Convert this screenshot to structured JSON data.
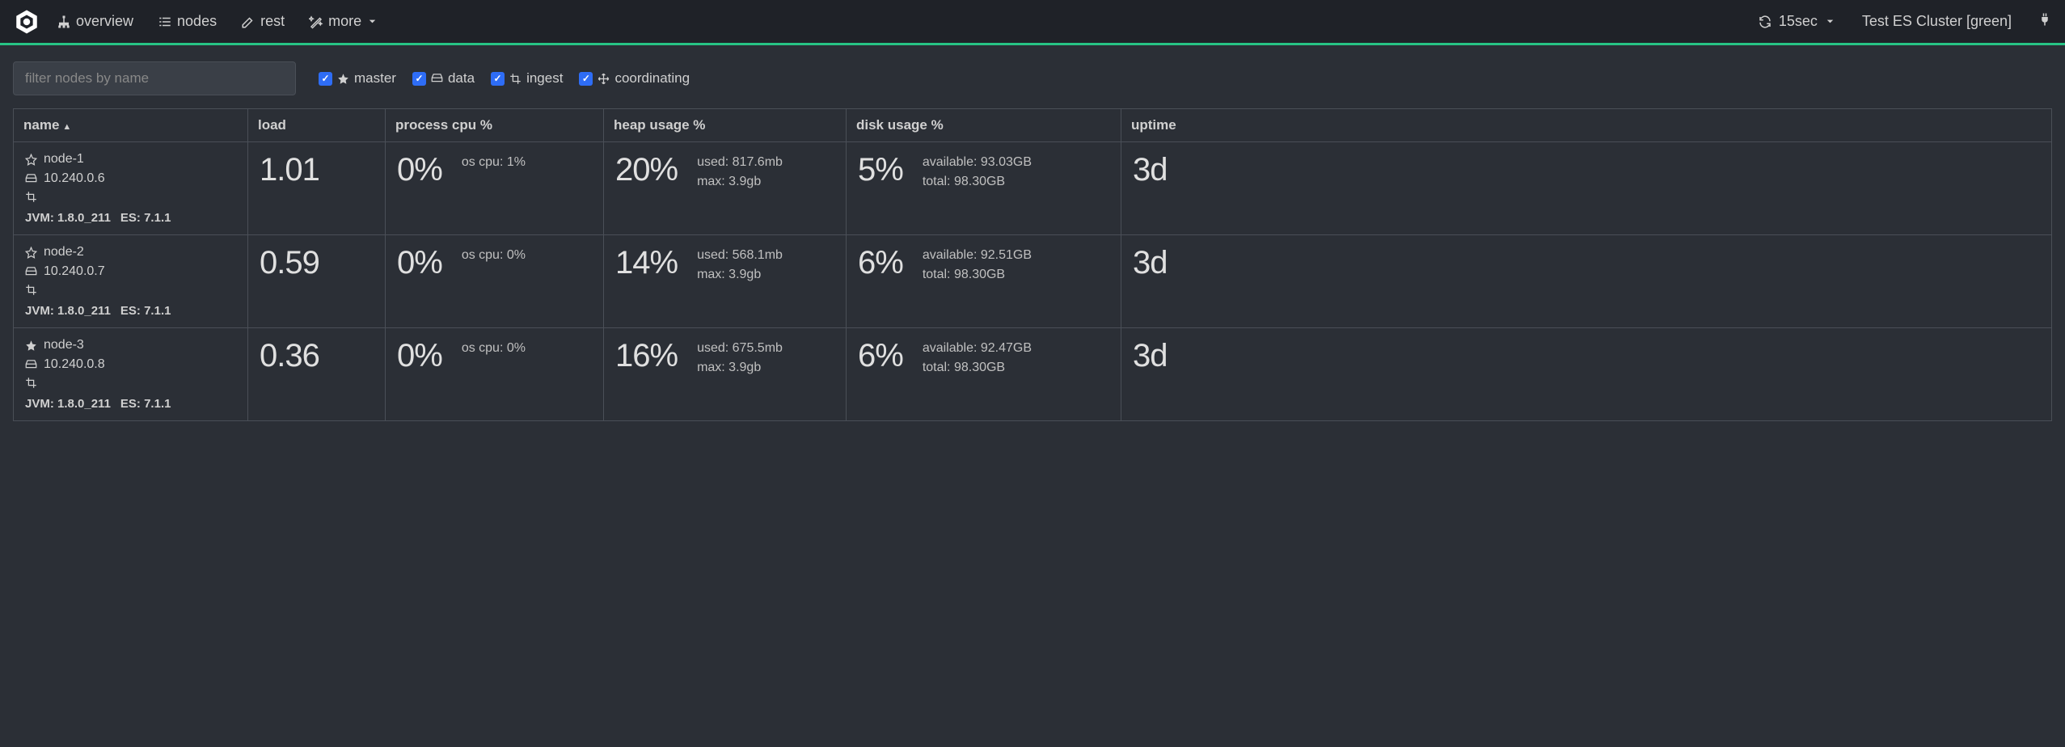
{
  "nav": {
    "overview": "overview",
    "nodes": "nodes",
    "rest": "rest",
    "more": "more"
  },
  "header": {
    "refresh_interval": "15sec",
    "cluster_name": "Test ES Cluster [green]"
  },
  "toolbar": {
    "filter_placeholder": "filter nodes by name",
    "roles": {
      "master": "master",
      "data": "data",
      "ingest": "ingest",
      "coordinating": "coordinating"
    }
  },
  "columns": {
    "name": "name",
    "load": "load",
    "process_cpu": "process cpu %",
    "heap": "heap usage %",
    "disk": "disk usage %",
    "uptime": "uptime"
  },
  "rows": [
    {
      "name": "node-1",
      "ip": "10.240.0.6",
      "is_master": false,
      "jvm": "JVM: 1.8.0_211",
      "es": "ES: 7.1.1",
      "load": "1.01",
      "cpu": "0%",
      "os_cpu": "os cpu: 1%",
      "heap": "20%",
      "heap_used": "used: 817.6mb",
      "heap_max": "max: 3.9gb",
      "disk": "5%",
      "disk_avail": "available: 93.03GB",
      "disk_total": "total: 98.30GB",
      "uptime": "3d"
    },
    {
      "name": "node-2",
      "ip": "10.240.0.7",
      "is_master": false,
      "jvm": "JVM: 1.8.0_211",
      "es": "ES: 7.1.1",
      "load": "0.59",
      "cpu": "0%",
      "os_cpu": "os cpu: 0%",
      "heap": "14%",
      "heap_used": "used: 568.1mb",
      "heap_max": "max: 3.9gb",
      "disk": "6%",
      "disk_avail": "available: 92.51GB",
      "disk_total": "total: 98.30GB",
      "uptime": "3d"
    },
    {
      "name": "node-3",
      "ip": "10.240.0.8",
      "is_master": true,
      "jvm": "JVM: 1.8.0_211",
      "es": "ES: 7.1.1",
      "load": "0.36",
      "cpu": "0%",
      "os_cpu": "os cpu: 0%",
      "heap": "16%",
      "heap_used": "used: 675.5mb",
      "heap_max": "max: 3.9gb",
      "disk": "6%",
      "disk_avail": "available: 92.47GB",
      "disk_total": "total: 98.30GB",
      "uptime": "3d"
    }
  ]
}
